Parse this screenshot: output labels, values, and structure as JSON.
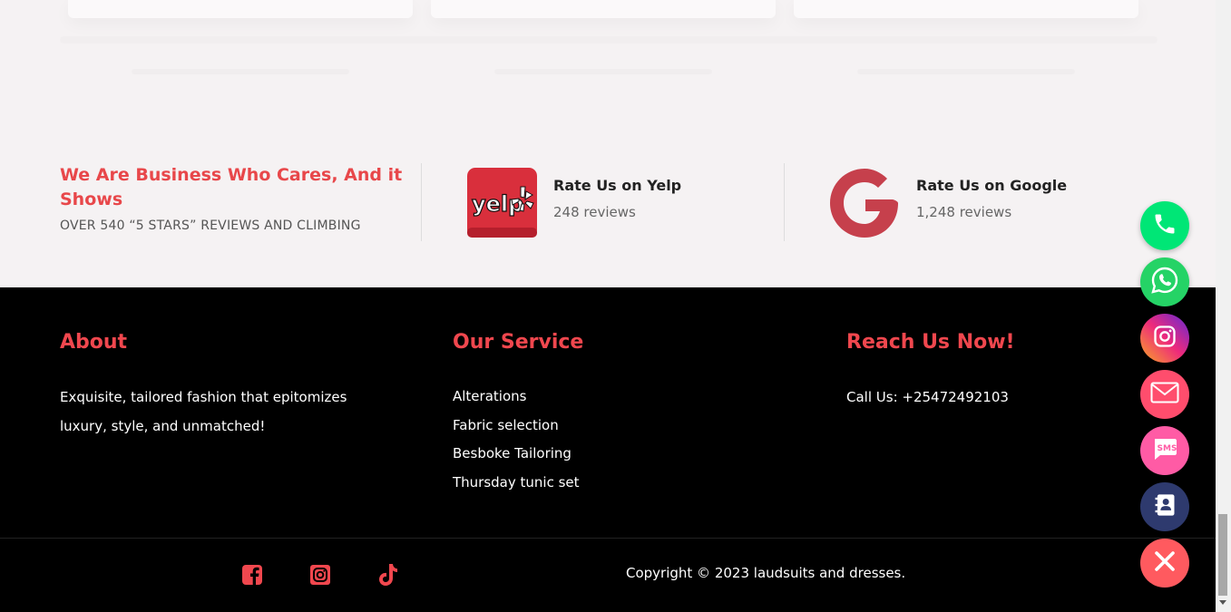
{
  "reviews": {
    "title": "We Are Business Who Cares, And it Shows",
    "subtitle": "OVER 540 “5 STARS” REVIEWS AND CLIMBING",
    "yelp": {
      "logo_text": "yelp",
      "name": "Rate Us on Yelp",
      "count": "248 reviews"
    },
    "google": {
      "logo_text": "G",
      "name": "Rate Us on Google",
      "count": "1,248 reviews"
    }
  },
  "footer": {
    "about": {
      "title": "About",
      "line1": "Exquisite, tailored fashion that epitomizes",
      "line2": "luxury, style, and unmatched!"
    },
    "service": {
      "title": "Our Service",
      "items": [
        "Alterations",
        "Fabric selection",
        "Besboke Tailoring",
        "Thursday tunic set"
      ]
    },
    "reach": {
      "title": "Reach Us Now!",
      "phone": "Call Us: +25472492103"
    },
    "social": [
      "facebook-icon",
      "instagram-icon",
      "tiktok-icon"
    ],
    "copyright": "Copyright © 2023 laudsuits and dresses."
  },
  "floating_buttons": {
    "phone_label": "SMS",
    "icons": [
      "phone-icon",
      "whatsapp-icon",
      "instagram-icon",
      "mail-icon",
      "sms-icon",
      "contacts-icon",
      "close-icon"
    ]
  },
  "colors": {
    "accent": "#f0474e",
    "title_red": "#e8474a",
    "yelp_red": "#d32323",
    "google_red": "#c6404c",
    "whatsapp": "#25d366",
    "phone": "#00e676",
    "mail": "#ff4d6d",
    "sms": "#ff5ba5",
    "contacts": "#2e3a6e",
    "close": "#ff5a5f"
  }
}
